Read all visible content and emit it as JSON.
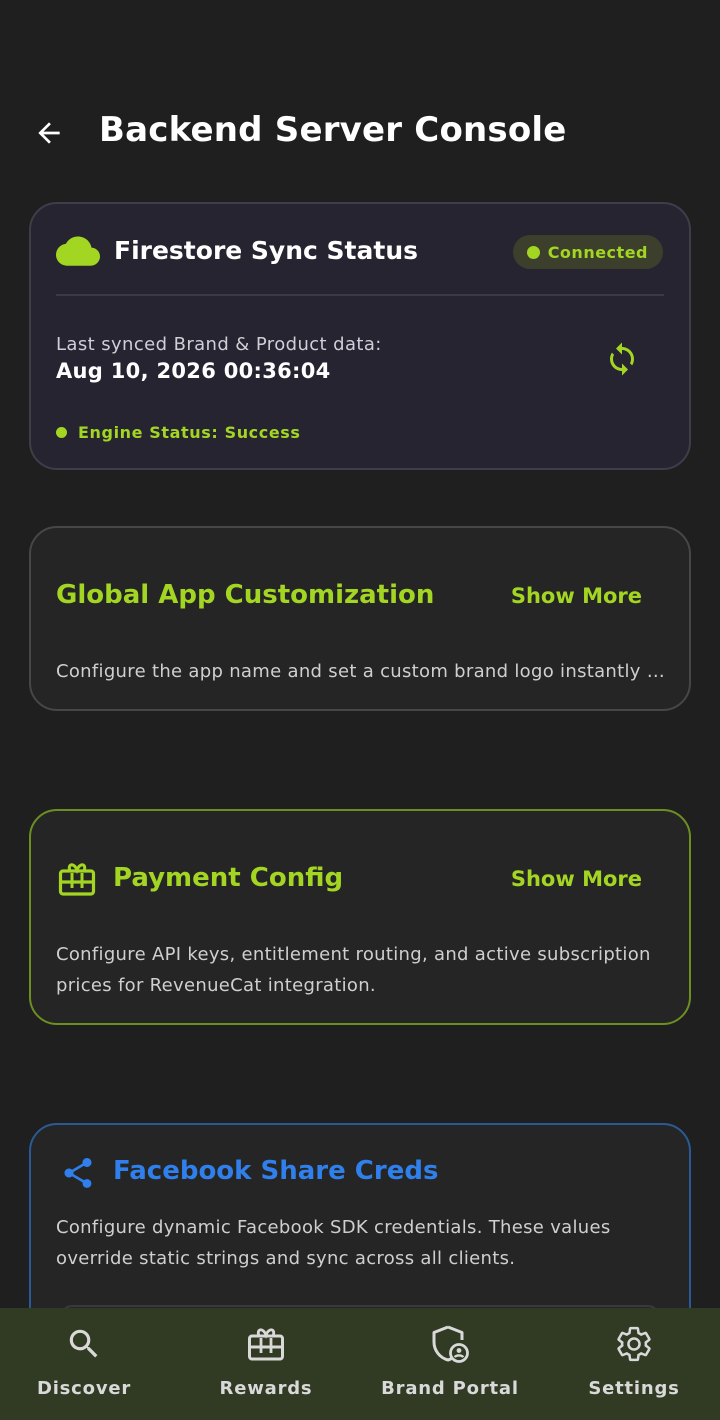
{
  "header": {
    "title": "Backend Server Console",
    "back_icon": "arrow-left-icon"
  },
  "sync_card": {
    "icon": "cloud-icon",
    "title": "Firestore Sync Status",
    "status_label": "Connected",
    "last_synced_label": "Last synced Brand & Product data:",
    "last_synced_value": "Aug 10, 2026 00:36:04",
    "refresh_icon": "sync-refresh-icon",
    "engine_status": "Engine Status: Success"
  },
  "global_card": {
    "title": "Global App Customization",
    "show_more": "Show More",
    "description": "Configure the app name and set a custom brand logo instantly across all clients."
  },
  "payment_card": {
    "icon": "gift-card-icon",
    "title": "Payment Config",
    "show_more": "Show More",
    "description": "Configure API keys, entitlement routing, and active subscription prices for RevenueCat integration."
  },
  "facebook_card": {
    "icon": "share-icon",
    "title": "Facebook Share Creds",
    "description": "Configure dynamic Facebook SDK credentials. These values override static strings and sync across all clients."
  },
  "bottom_nav": {
    "items": [
      {
        "label": "Discover",
        "icon": "search-icon"
      },
      {
        "label": "Rewards",
        "icon": "gift-icon"
      },
      {
        "label": "Brand Portal",
        "icon": "shield-user-icon"
      },
      {
        "label": "Settings",
        "icon": "gear-icon"
      }
    ]
  },
  "colors": {
    "background": "#1f1f1f",
    "accent_green": "#a3d622",
    "accent_blue": "#2f80ed",
    "nav_background": "#313a22"
  }
}
